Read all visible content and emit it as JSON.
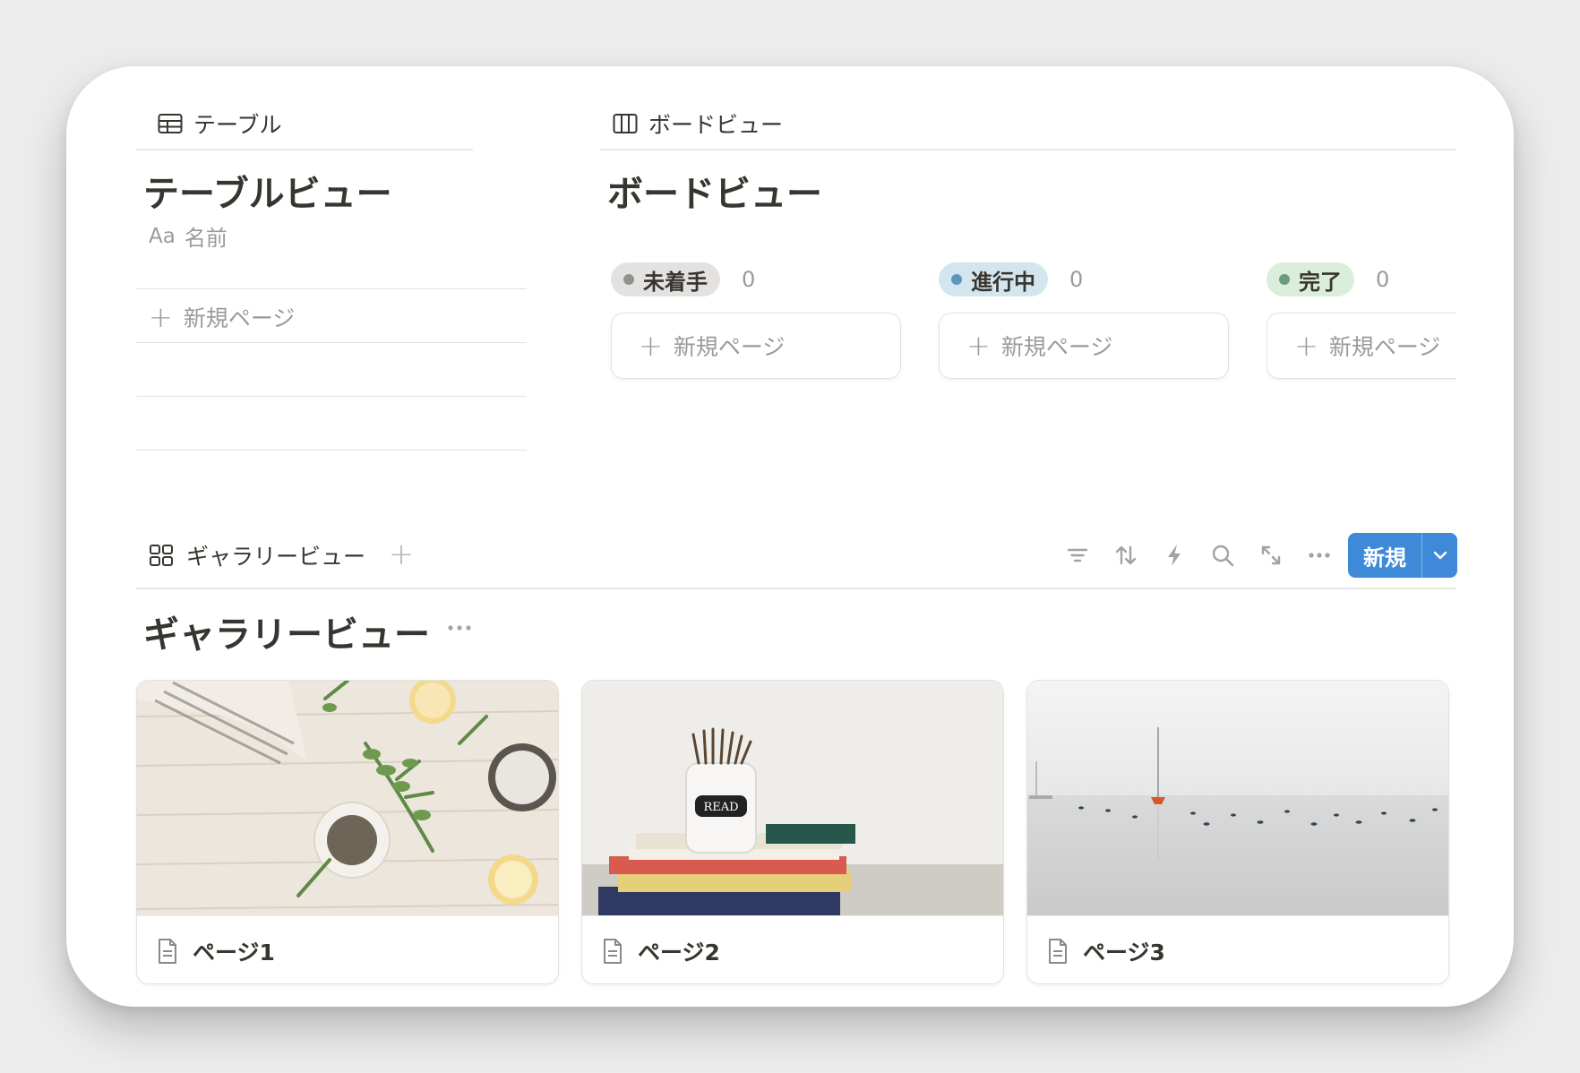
{
  "table_view": {
    "tab_label": "テーブル",
    "title": "テーブルビュー",
    "column_icon_text": "Aa",
    "column_name": "名前",
    "new_page": "新規ページ"
  },
  "board_view": {
    "tab_label": "ボードビュー",
    "title": "ボードビュー",
    "columns": [
      {
        "label": "未着手",
        "count": "0",
        "bg": "#e3e2e0",
        "dot": "#91918e"
      },
      {
        "label": "進行中",
        "count": "0",
        "bg": "#d3e5ef",
        "dot": "#5b97bd"
      },
      {
        "label": "完了",
        "count": "0",
        "bg": "#dbeddb",
        "dot": "#6c9b7d"
      }
    ],
    "new_page": "新規ページ"
  },
  "gallery_view": {
    "tab_label": "ギャラリービュー",
    "title": "ギャラリービュー",
    "new_button": "新規",
    "cards": [
      {
        "title": "ページ1"
      },
      {
        "title": "ページ2"
      },
      {
        "title": "ページ3"
      }
    ],
    "toolbar_icons": [
      "filter-icon",
      "sort-icon",
      "automation-icon",
      "search-icon",
      "expand-icon",
      "more-icon"
    ]
  },
  "colors": {
    "accent": "#3f8ad8",
    "text": "#37352f",
    "muted": "#9b9a97"
  },
  "image_text": {
    "jar_label": "READ"
  }
}
